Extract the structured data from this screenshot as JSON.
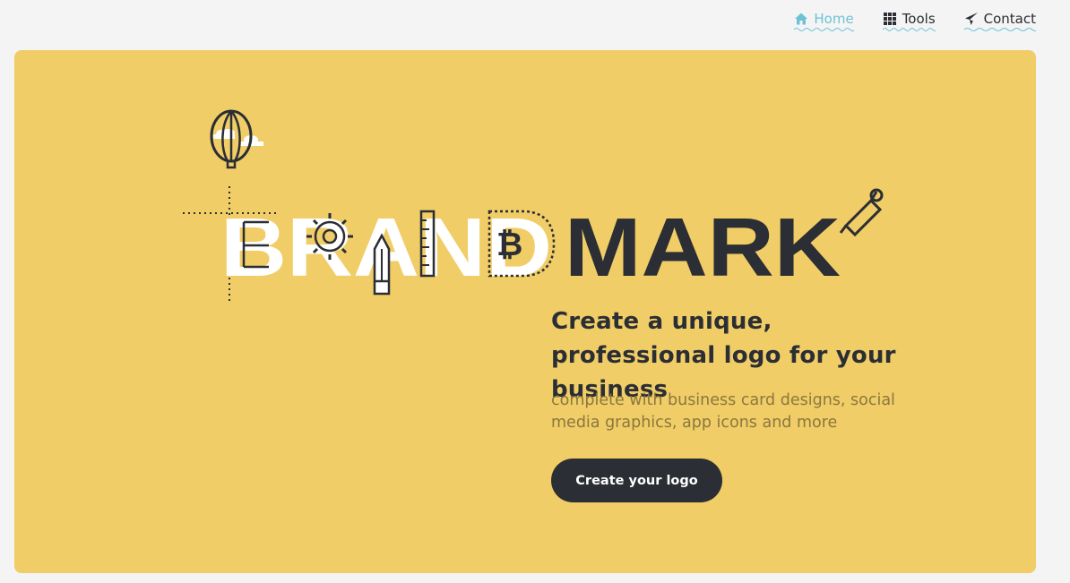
{
  "nav": {
    "items": [
      {
        "label": "Home",
        "icon": "home-icon",
        "active": true
      },
      {
        "label": "Tools",
        "icon": "grid-icon",
        "active": false
      },
      {
        "label": "Contact",
        "icon": "paper-plane-icon",
        "active": false
      }
    ]
  },
  "hero": {
    "logo_word_light": "BRAND",
    "logo_word_dark": "MARK",
    "headline": "Create a unique, professional logo for your business",
    "subline": "complete with business card designs, social media graphics, app icons and more",
    "cta_label": "Create your logo"
  },
  "colors": {
    "accent": "#6ec2d6",
    "hero_background": "#f0cd66",
    "dark": "#2b2e34",
    "page_background": "#f4f4f4"
  }
}
